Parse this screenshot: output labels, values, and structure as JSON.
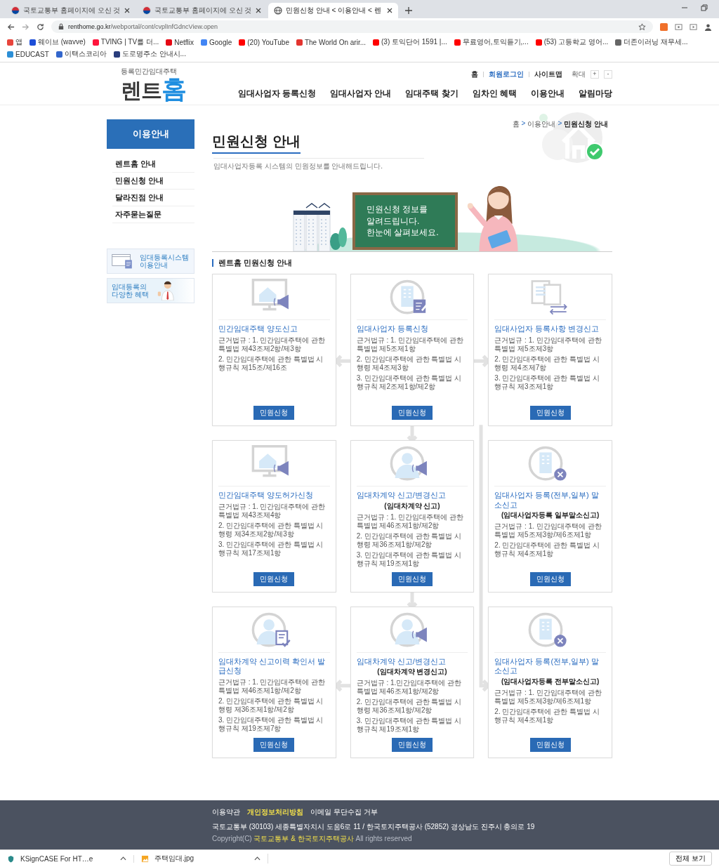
{
  "browser": {
    "tabs": [
      {
        "title": "국토교통부 홈페이지에 오신 것",
        "kind": "flag",
        "selected": false
      },
      {
        "title": "국토교통부 홈페이지에 오신 것",
        "kind": "flag",
        "selected": false
      },
      {
        "title": "민원신청 안내 < 이용안내 < 렌",
        "kind": "globe",
        "selected": true
      }
    ],
    "url_domain": "renthome.go.kr",
    "url_path": "/webportal/cont/cvplInfGdncView.open",
    "bookmarks": [
      {
        "label": "앱",
        "color": "#e8453c"
      },
      {
        "label": "웨이브 (wavve)",
        "color": "#1e4fd8"
      },
      {
        "label": "TVING | TV를 더...",
        "color": "#ff153c"
      },
      {
        "label": "Netflix",
        "color": "#e50914"
      },
      {
        "label": "Google",
        "color": "#4285f4"
      },
      {
        "label": "(20) YouTube",
        "color": "#ff0000"
      },
      {
        "label": "The World On arir...",
        "color": "#e3342f"
      },
      {
        "label": "(3) 토익단어 1591 |...",
        "color": "#ff0000"
      },
      {
        "label": "무료영어,토익듣기,...",
        "color": "#ff0000"
      },
      {
        "label": "(53) 고등학교 영어...",
        "color": "#ff0000"
      },
      {
        "label": "더존이러닝 재무세...",
        "color": "#666666"
      },
      {
        "label": "EDUCAST",
        "color": "#2c8fd6"
      },
      {
        "label": "이택스코리아",
        "color": "#3366cc"
      },
      {
        "label": "도로명주소 안내시...",
        "color": "#2a3d7c"
      }
    ]
  },
  "header": {
    "logo_caption": "등록민간임대주택",
    "logo_main": "렌트",
    "logo_accent": "홈",
    "util_links": [
      {
        "label": "홈",
        "color": "#333333"
      },
      {
        "label": "회원로그인",
        "color": "#2a6cc0"
      },
      {
        "label": "사이트맵",
        "color": "#333333"
      }
    ],
    "zoom_label": "확대",
    "zoom_in": "+",
    "zoom_out": "-",
    "nav": [
      "임대사업자 등록신청",
      "임대사업자 안내",
      "임대주택 찾기",
      "임차인 혜택",
      "이용안내",
      "알림마당"
    ]
  },
  "sidebar": {
    "title": "이용안내",
    "items": [
      "렌트홈 안내",
      "민원신청 안내",
      "달라진점 안내",
      "자주묻는질문"
    ],
    "banners": [
      {
        "kind": "system",
        "lines": [
          "임대등록시스템",
          "이용안내"
        ]
      },
      {
        "kind": "benefit",
        "lines": [
          "임대등록의",
          "다양한 혜택"
        ]
      }
    ]
  },
  "breadcrumb": [
    "홈",
    "이용안내",
    "민원신청 안내"
  ],
  "breadcrumb_separator": ">",
  "page_title": "민원신청 안내",
  "page_subtitle": "임대사업자등록 시스템의 민원정보를 안내해드립니다.",
  "chalkboard_lines": [
    "민원신청 정보를",
    "알려드립니다.",
    "한눈에 살펴보세요."
  ],
  "section_title": "렌트홈 민원신청 안내",
  "cards": [
    {
      "kind": "monitor-megaphone",
      "title": "민간임대주택 양도신고",
      "basis": [
        "근거법규 : 1. 민간임대주택에 관한 특별법 제43조제2항/제3항",
        "2. 민간임대주택에 관한 특별법 시행규칙 제15조/제16조"
      ],
      "button": "민원신청"
    },
    {
      "kind": "building-edit",
      "title": "임대사업자 등록신청",
      "basis": [
        "근거법규 : 1. 민간임대주택에 관한 특별법 제5조제1항",
        "2. 민간임대주택에 관한 특별법 시행령 제4조제3항",
        "3. 민간임대주택에 관한 특별법 시행규칙 제2조제1항/제2항"
      ],
      "button": "민원신청"
    },
    {
      "kind": "documents-arrows",
      "title": "임대사업자 등록사항 변경신고",
      "basis": [
        "근거법규 : 1. 민간임대주택에 관한 특별법 제5조제3항",
        "2. 민간임대주택에 관한 특별법 시행령 제4조제7항",
        "3. 민간임대주택에 관한 특별법 시행규칙 제3조제1항"
      ],
      "button": "민원신청"
    },
    {
      "kind": "monitor-megaphone",
      "title": "민간임대주택 양도허가신청",
      "basis": [
        "근거법규 : 1. 민간임대주택에 관한 특별법 제43조제4항",
        "2. 민간임대주택에 관한 특별법 시행령 제34조제2항/제3항",
        "3. 민간임대주택에 관한 특별법 시행규칙 제17조제1항"
      ],
      "button": "민원신청"
    },
    {
      "kind": "person-megaphone",
      "title": "임대차계약 신고/변경신고",
      "subtitle": "(임대차계약 신고)",
      "basis": [
        "근거법규 : 1. 민간임대주택에 관한 특별법 제46조제1항/제2항",
        "2. 민간임대주택에 관한 특별법 시행령 제36조제1항/제2항",
        "3. 민간임대주택에 관한 특별법 시행규칙 제19조제1항"
      ],
      "button": "민원신청"
    },
    {
      "kind": "building-cancel",
      "title": "임대사업자 등록(전부,일부) 말소신고",
      "subtitle": "(임대사업자등록 일부말소신고)",
      "basis": [
        "근거법규 : 1. 민간임대주택에 관한 특별법 제5조제3항/제6조제1항",
        "2. 민간임대주택에 관한 특별법 시행규칙 제4조제1항"
      ],
      "button": "민원신청"
    },
    {
      "kind": "person-document",
      "title": "임대차계약 신고이력 확인서 발급신청",
      "basis": [
        "근거법규 : 1. 민간임대주택에 관한 특별법 제46조제1항/제2항",
        "2. 민간임대주택에 관한 특별법 시행령 제36조제1항/제2항",
        "3. 민간임대주택에 관한 특별법 시행규칙 제19조제7항"
      ],
      "button": "민원신청"
    },
    {
      "kind": "person-megaphone",
      "title": "임대차계약 신고/변경신고",
      "subtitle": "(임대차계약 변경신고)",
      "basis": [
        "근거법규 : 1.민간임대주택에 관한 특별법 제46조제1항/제2항",
        "2. 민간임대주택에 관한 특별법 시행령 제36조제1항/제2항",
        "3. 민간임대주택에 관한 특별법 시행규칙 제19조제1항"
      ],
      "button": "민원신청"
    },
    {
      "kind": "building-cancel",
      "title": "임대사업자 등록(전부,일부) 말소신고",
      "subtitle": "(임대사업자등록 전부말소신고)",
      "basis": [
        "근거법규 : 1. 민간임대주택에 관한 특별법 제5조제3항/제6조제1항",
        "2. 민간임대주택에 관한 특별법 시행규칙 제4조제1항"
      ],
      "button": "민원신청"
    }
  ],
  "footer": {
    "links": [
      {
        "label": "이용약관",
        "highlighted": false
      },
      {
        "label": "개인정보처리방침",
        "highlighted": true
      },
      {
        "label": "이메일 무단수집 거부",
        "highlighted": false
      }
    ],
    "address": "국토교통부 (30103) 세종특별자치시 도움6로 11 / 한국토지주택공사 (52852) 경상남도 진주시 충의로 19",
    "copyright_prefix": "Copyright(C)",
    "copyright_owner": "국토교통부 & 한국토지주택공사",
    "copyright_suffix": "All rights reserved"
  },
  "downloads": {
    "items": [
      {
        "name": "KSignCASE For HT…e",
        "kind": "shield"
      },
      {
        "name": "주택임대.jpg",
        "kind": "image"
      }
    ],
    "show_all": "전체 보기"
  }
}
